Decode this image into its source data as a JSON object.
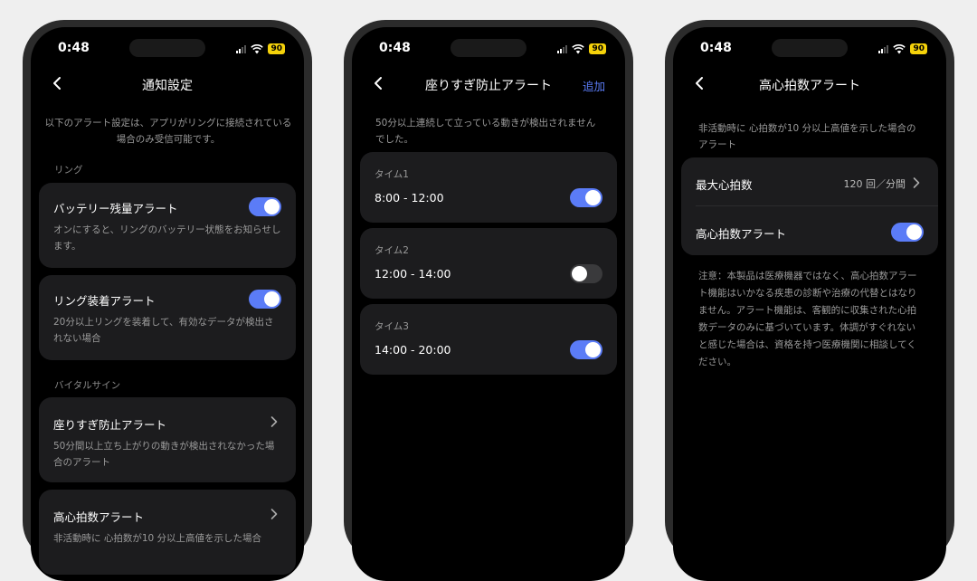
{
  "status": {
    "time": "0:48",
    "battery": "90"
  },
  "screen1": {
    "title": "通知設定",
    "intro": "以下のアラート設定は、アプリがリングに接続されている場合のみ受信可能です。",
    "section_ring": "リング",
    "battery_alert": {
      "title": "バッテリー残量アラート",
      "desc": "オンにすると、リングのバッテリー状態をお知らせします。",
      "enabled": true
    },
    "wear_alert": {
      "title": "リング装着アラート",
      "desc": "20分以上リングを装着して、有効なデータが検出されない場合",
      "enabled": true
    },
    "section_vital": "バイタルサイン",
    "sedentary": {
      "title": "座りすぎ防止アラート",
      "desc": "50分間以上立ち上がりの動きが検出されなかった場合のアラート"
    },
    "heart": {
      "title": "高心拍数アラート",
      "desc": "非活動時に 心拍数が10 分以上高値を示した場合"
    }
  },
  "screen2": {
    "title": "座りすぎ防止アラート",
    "action": "追加",
    "intro": "50分以上連続して立っている動きが検出されませんでした。",
    "times": [
      {
        "label": "タイム1",
        "range": "8:00 - 12:00",
        "enabled": true
      },
      {
        "label": "タイム2",
        "range": "12:00 - 14:00",
        "enabled": false
      },
      {
        "label": "タイム3",
        "range": "14:00 - 20:00",
        "enabled": true
      }
    ]
  },
  "screen3": {
    "title": "高心拍数アラート",
    "intro": "非活動時に 心拍数が10 分以上高値を示した場合のアラート",
    "max_hr_label": "最大心拍数",
    "max_hr_value": "120 回／分間",
    "alert_label": "高心拍数アラート",
    "alert_enabled": true,
    "note": "注意：本製品は医療機器ではなく、高心拍数アラート機能はいかなる疾患の診断や治療の代替とはなりません。アラート機能は、客観的に収集された心拍数データのみに基づいています。体調がすぐれないと感じた場合は、資格を持つ医療機関に相談してください。"
  },
  "icons": [
    "chevron-left-icon",
    "chevron-right-icon",
    "signal-icon",
    "wifi-icon",
    "battery-icon",
    "toggle-switch"
  ],
  "colors": {
    "accent": "#5b7cf7",
    "card": "#1c1c1e",
    "battery": "#f5d20a"
  }
}
